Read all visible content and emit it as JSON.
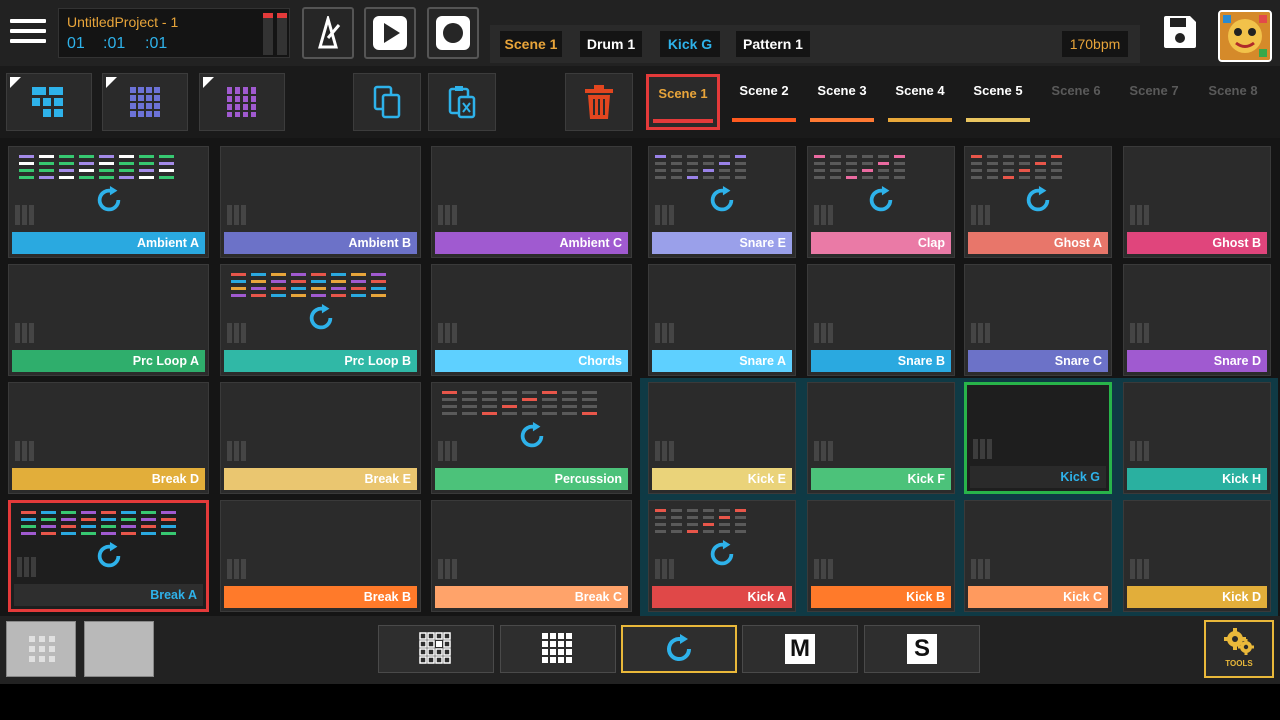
{
  "header": {
    "project_name": "UntitledProject - 1",
    "time": [
      "01",
      ":01",
      ":01"
    ],
    "tracks": [
      {
        "label": "Scene 1",
        "color": "#e9a53a"
      },
      {
        "label": "Drum 1",
        "color": "#ffffff"
      },
      {
        "label": "Kick G",
        "color": "#2eb2ea"
      },
      {
        "label": "Pattern 1",
        "color": "#ffffff"
      }
    ],
    "bpm": "170bpm",
    "icons": [
      "menu-icon",
      "metronome-icon",
      "play-icon",
      "record-icon",
      "save-icon",
      "avatar-icon"
    ]
  },
  "toolbar": {
    "tool_icons": [
      "arrange-view-icon",
      "pad-grid-icon",
      "sequencer-view-icon",
      "copy-icon",
      "paste-icon",
      "delete-icon"
    ],
    "scenes": [
      {
        "label": "Scene 1",
        "active": true,
        "bar_color": "#e43a3a"
      },
      {
        "label": "Scene 2",
        "active": false,
        "bar_color": "#ff5a1f"
      },
      {
        "label": "Scene 3",
        "active": false,
        "bar_color": "#ff7a33"
      },
      {
        "label": "Scene 4",
        "active": false,
        "bar_color": "#e9a83a"
      },
      {
        "label": "Scene 5",
        "active": false,
        "bar_color": "#eac560"
      },
      {
        "label": "Scene 6",
        "active": false,
        "bar_color": ""
      },
      {
        "label": "Scene 7",
        "active": false,
        "bar_color": ""
      },
      {
        "label": "Scene 8",
        "active": false,
        "bar_color": ""
      }
    ]
  },
  "clips": [
    [
      {
        "label": "Ambient A",
        "color": "#2aa9e0",
        "loop": true,
        "pattern": [
          "#a48be8",
          "#ffffff",
          "#37c871",
          "#37c871"
        ]
      },
      {
        "label": "Ambient B",
        "color": "#6c72c8",
        "loop": false
      },
      {
        "label": "Ambient C",
        "color": "#a05ad0",
        "loop": false
      },
      {
        "label": "Snare E",
        "color": "#9aa0ea",
        "loop": true,
        "pattern": [
          "#9a82e8"
        ]
      },
      {
        "label": "Clap",
        "color": "#ea7aa6",
        "loop": true,
        "pattern": [
          "#ea6aa0"
        ]
      },
      {
        "label": "Ghost A",
        "color": "#e8766a",
        "loop": true,
        "pattern": [
          "#e8564a"
        ]
      },
      {
        "label": "Ghost B",
        "color": "#e0457c",
        "loop": false
      }
    ],
    [
      {
        "label": "Prc Loop A",
        "color": "#2fae6c",
        "loop": false
      },
      {
        "label": "Prc Loop B",
        "color": "#30b8a6",
        "loop": true,
        "pattern": [
          "#e8564a",
          "#2aa9e0",
          "#e8a53a",
          "#a05ad0"
        ]
      },
      {
        "label": "Chords",
        "color": "#5ed0ff",
        "loop": false
      },
      {
        "label": "Snare A",
        "color": "#5ed0ff",
        "loop": false
      },
      {
        "label": "Snare B",
        "color": "#2aa9e0",
        "loop": false
      },
      {
        "label": "Snare C",
        "color": "#6c72c8",
        "loop": false
      },
      {
        "label": "Snare D",
        "color": "#a05ad0",
        "loop": false
      }
    ],
    [
      {
        "label": "Break D",
        "color": "#e2ae3a",
        "loop": false
      },
      {
        "label": "Break E",
        "color": "#eac670",
        "loop": false
      },
      {
        "label": "Percussion",
        "color": "#4cc27a",
        "loop": true,
        "pattern": [
          "#e8564a"
        ]
      },
      {
        "label": "Kick E",
        "color": "#ead37a",
        "loop": false
      },
      {
        "label": "Kick F",
        "color": "#4cc27a",
        "loop": false
      },
      {
        "label": "Kick G",
        "color": "#222222",
        "loop": false,
        "selected": true
      },
      {
        "label": "Kick H",
        "color": "#2ab0a0",
        "loop": false
      }
    ],
    [
      {
        "label": "Break A",
        "color": "#333333",
        "loop": true,
        "pattern": [
          "#e8564a",
          "#2aa9e0",
          "#37c871",
          "#a05ad0"
        ],
        "active": true
      },
      {
        "label": "Break B",
        "color": "#ff7a2a",
        "loop": false
      },
      {
        "label": "Break C",
        "color": "#ffa36a",
        "loop": false
      },
      {
        "label": "Kick A",
        "color": "#e04848",
        "loop": true,
        "pattern": [
          "#e8564a"
        ]
      },
      {
        "label": "Kick B",
        "color": "#ff7a2a",
        "loop": false
      },
      {
        "label": "Kick C",
        "color": "#ff9a5e",
        "loop": false
      },
      {
        "label": "Kick D",
        "color": "#e2ae3a",
        "loop": false
      }
    ]
  ],
  "bottom": {
    "modes": [
      "pads-grid-icon",
      "sequencer-grid-icon",
      "loop-icon",
      "M",
      "S"
    ],
    "tools_label": "TOOLS"
  },
  "colors": {
    "accent_cyan": "#2eb2ea",
    "accent_orange": "#e9a53a",
    "active_red": "#e43a3a",
    "selected_green": "#28b44a"
  }
}
